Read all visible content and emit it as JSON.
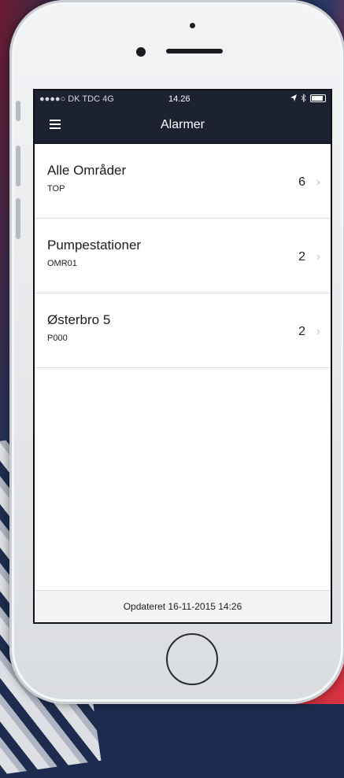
{
  "statusbar": {
    "carrier": "●●●●○ DK TDC  4G",
    "time": "14.26",
    "location_icon": "location-arrow-icon",
    "bluetooth_icon": "bluetooth-icon",
    "battery_icon": "battery-icon"
  },
  "navbar": {
    "title": "Alarmer",
    "menu_icon": "hamburger-menu-icon"
  },
  "rows": [
    {
      "title": "Alle Områder",
      "subtitle": "TOP",
      "count": "6"
    },
    {
      "title": "Pumpestationer",
      "subtitle": "OMR01",
      "count": "2"
    },
    {
      "title": "Østerbro 5",
      "subtitle": "P000",
      "count": "2"
    }
  ],
  "chevron": "›",
  "footer": {
    "updated": "Opdateret 16-11-2015 14:26"
  },
  "colors": {
    "navbar": "#1d2233",
    "separator": "#dcdde0",
    "chevron": "#c3c5ca"
  }
}
